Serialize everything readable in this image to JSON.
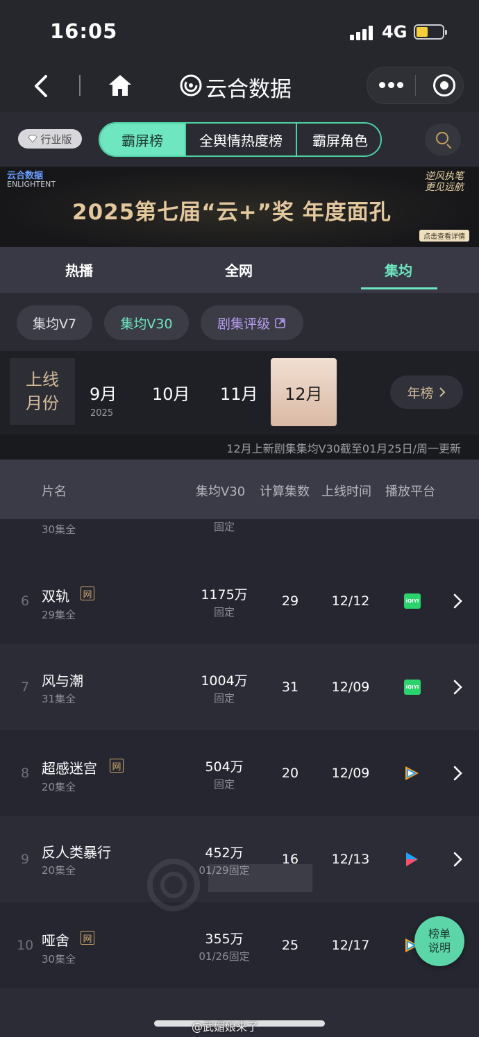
{
  "status_bar": {
    "time": "16:05",
    "network": "4G"
  },
  "nav": {
    "brand": "云合数据"
  },
  "category": {
    "industry_badge": "行业版",
    "segments": [
      "霸屏榜",
      "全舆情热度榜",
      "霸屏角色"
    ],
    "active_segment": 0
  },
  "banner": {
    "title": "2025第七届“云+”奖  年度面孔",
    "logo_cn": "云合数据",
    "logo_en": "ENLIGHTENT",
    "tagline": "逆风执笔 更见远航",
    "link": "点击查看详情"
  },
  "tabs": {
    "items": [
      "热播",
      "全网",
      "集均"
    ],
    "active": 2
  },
  "chips": {
    "items": [
      "集均V7",
      "集均V30",
      "剧集评级"
    ],
    "active": 1
  },
  "months": {
    "label": "上线月份",
    "items": [
      "9月",
      "10月",
      "11月",
      "12月"
    ],
    "year_under_first": "2025",
    "selected": "12月",
    "year_button": "年榜"
  },
  "update_note": "12月上新剧集集均V30截至01月25日/周一更新",
  "table": {
    "headers": [
      "片名",
      "集均V30",
      "计算集数",
      "上线时间",
      "播放平台"
    ],
    "partial_row": {
      "episodes": "30集全",
      "status": "固定"
    },
    "rows": [
      {
        "rank": "6",
        "title": "双轨",
        "net_badge": "网",
        "episodes": "29集全",
        "value": "1175万",
        "status": "固定",
        "count": "29",
        "date": "12/12",
        "platform": "iqiyi"
      },
      {
        "rank": "7",
        "title": "风与潮",
        "net_badge": "",
        "episodes": "31集全",
        "value": "1004万",
        "status": "固定",
        "count": "31",
        "date": "12/09",
        "platform": "iqiyi"
      },
      {
        "rank": "8",
        "title": "超感迷宫",
        "net_badge": "网",
        "episodes": "20集全",
        "value": "504万",
        "status": "固定",
        "count": "20",
        "date": "12/09",
        "platform": "tencent"
      },
      {
        "rank": "9",
        "title": "反人类暴行",
        "net_badge": "",
        "episodes": "20集全",
        "value": "452万",
        "status": "01/29固定",
        "count": "16",
        "date": "12/13",
        "platform": "youku"
      },
      {
        "rank": "10",
        "title": "哑舍",
        "net_badge": "网",
        "episodes": "30集全",
        "value": "355万",
        "status": "01/26固定",
        "count": "25",
        "date": "12/17",
        "platform": "tencent"
      }
    ]
  },
  "iqiyi_label": "iQIYI",
  "float_button": "榜单说明",
  "credit": "@武媚娘来了",
  "colors": {
    "accent": "#6ee6c0",
    "gold": "#d6bd99",
    "purple": "#b79cf0",
    "background": "#232429"
  }
}
